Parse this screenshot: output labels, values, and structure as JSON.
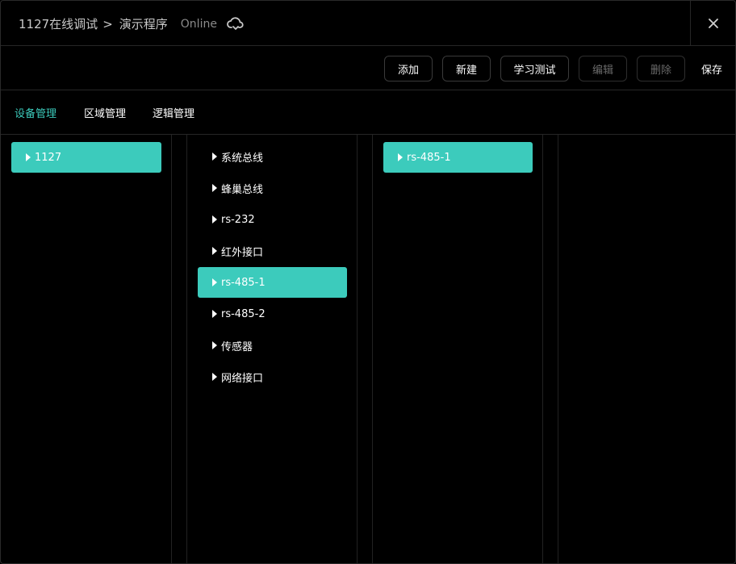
{
  "header": {
    "project": "1127在线调试",
    "separator": ">",
    "program": "演示程序",
    "status": "Online",
    "cloud_icon": "cloud-sync-icon",
    "close_icon": "close-icon"
  },
  "toolbar": {
    "add": "添加",
    "new": "新建",
    "learn_test": "学习测试",
    "edit": "编辑",
    "delete": "删除",
    "save": "保存"
  },
  "tabs": [
    {
      "label": "设备管理",
      "active": true
    },
    {
      "label": "区域管理",
      "active": false
    },
    {
      "label": "逻辑管理",
      "active": false
    }
  ],
  "columns": {
    "devices": [
      {
        "label": "1127",
        "selected": true
      }
    ],
    "interfaces": [
      {
        "label": "系统总线",
        "selected": false
      },
      {
        "label": "蜂巢总线",
        "selected": false
      },
      {
        "label": "rs-232",
        "selected": false
      },
      {
        "label": "红外接口",
        "selected": false
      },
      {
        "label": "rs-485-1",
        "selected": true
      },
      {
        "label": "rs-485-2",
        "selected": false
      },
      {
        "label": "传感器",
        "selected": false
      },
      {
        "label": "网络接口",
        "selected": false
      }
    ],
    "channels": [
      {
        "label": "rs-485-1",
        "selected": true
      }
    ]
  },
  "colors": {
    "accent": "#3ccbbc",
    "background": "#000000",
    "border": "#262626",
    "disabled_text": "#6a6a6a"
  }
}
